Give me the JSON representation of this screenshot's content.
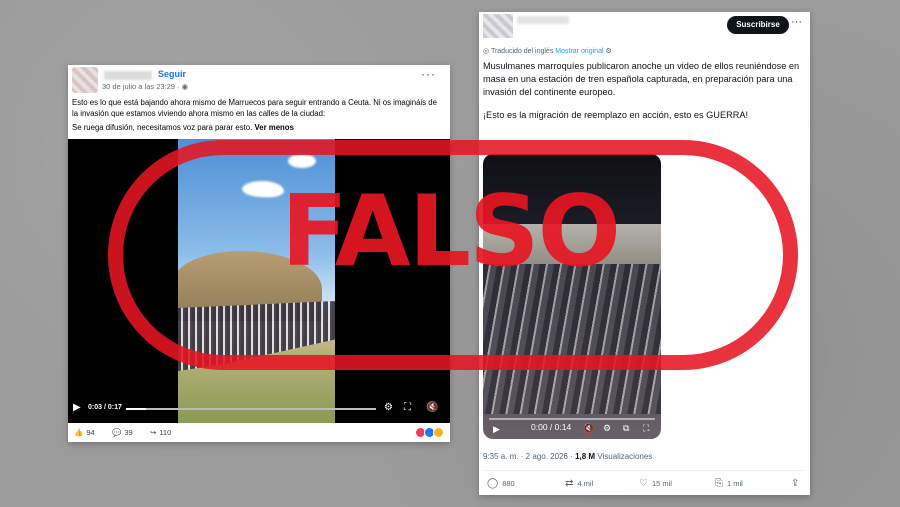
{
  "facebook_post": {
    "follow_label": "Seguir",
    "date": "30 de julio a las 23:29 · ",
    "paragraph1": "Esto es lo que está bajando ahora mismo de Marruecos para seguir entrando a Ceuta. Ni os imagináis de la invasión que estamos viviendo ahora mismo en las calles de la ciudad:",
    "paragraph2": "Se ruega difusión, necesitamos voz para parar esto. ",
    "see_more": "Ver menos",
    "video_time": "0:03 / 0:17",
    "video_progress": 0.08,
    "likes": "94",
    "comments": "39",
    "shares": "110"
  },
  "x_post": {
    "subscribe_label": "Suscribirse",
    "translated_from": "Traducido del inglés",
    "show_original": "Mostrar original",
    "text1": "Musulmanes marroquíes publicaron anoche un video de ellos reuniéndose en masa en una estación de tren española capturada, en preparación para una invasión del continente europeo.",
    "text2": "¡Esto es la migración de reemplazo en acción, esto es GUERRA!",
    "video_time": "0:00 / 0:14",
    "timestamp": "9:35 a. m. · 2 ago. 2026 · ",
    "views_count": "1,8 M",
    "views_label": "Visualizaciones",
    "replies": "880",
    "reposts": "4 mil",
    "likes": "15 mil",
    "bookmarks": "1 mil"
  },
  "stamp": {
    "word": "FALSO",
    "color": "#e61622"
  },
  "icons": [
    "more-icon",
    "globe-icon",
    "play-icon",
    "settings-icon",
    "volume-icon",
    "fullscreen-icon",
    "like-icon",
    "comment-icon",
    "share-icon",
    "reply-icon",
    "repost-icon",
    "heart-icon",
    "bookmark-icon",
    "upload-icon"
  ]
}
